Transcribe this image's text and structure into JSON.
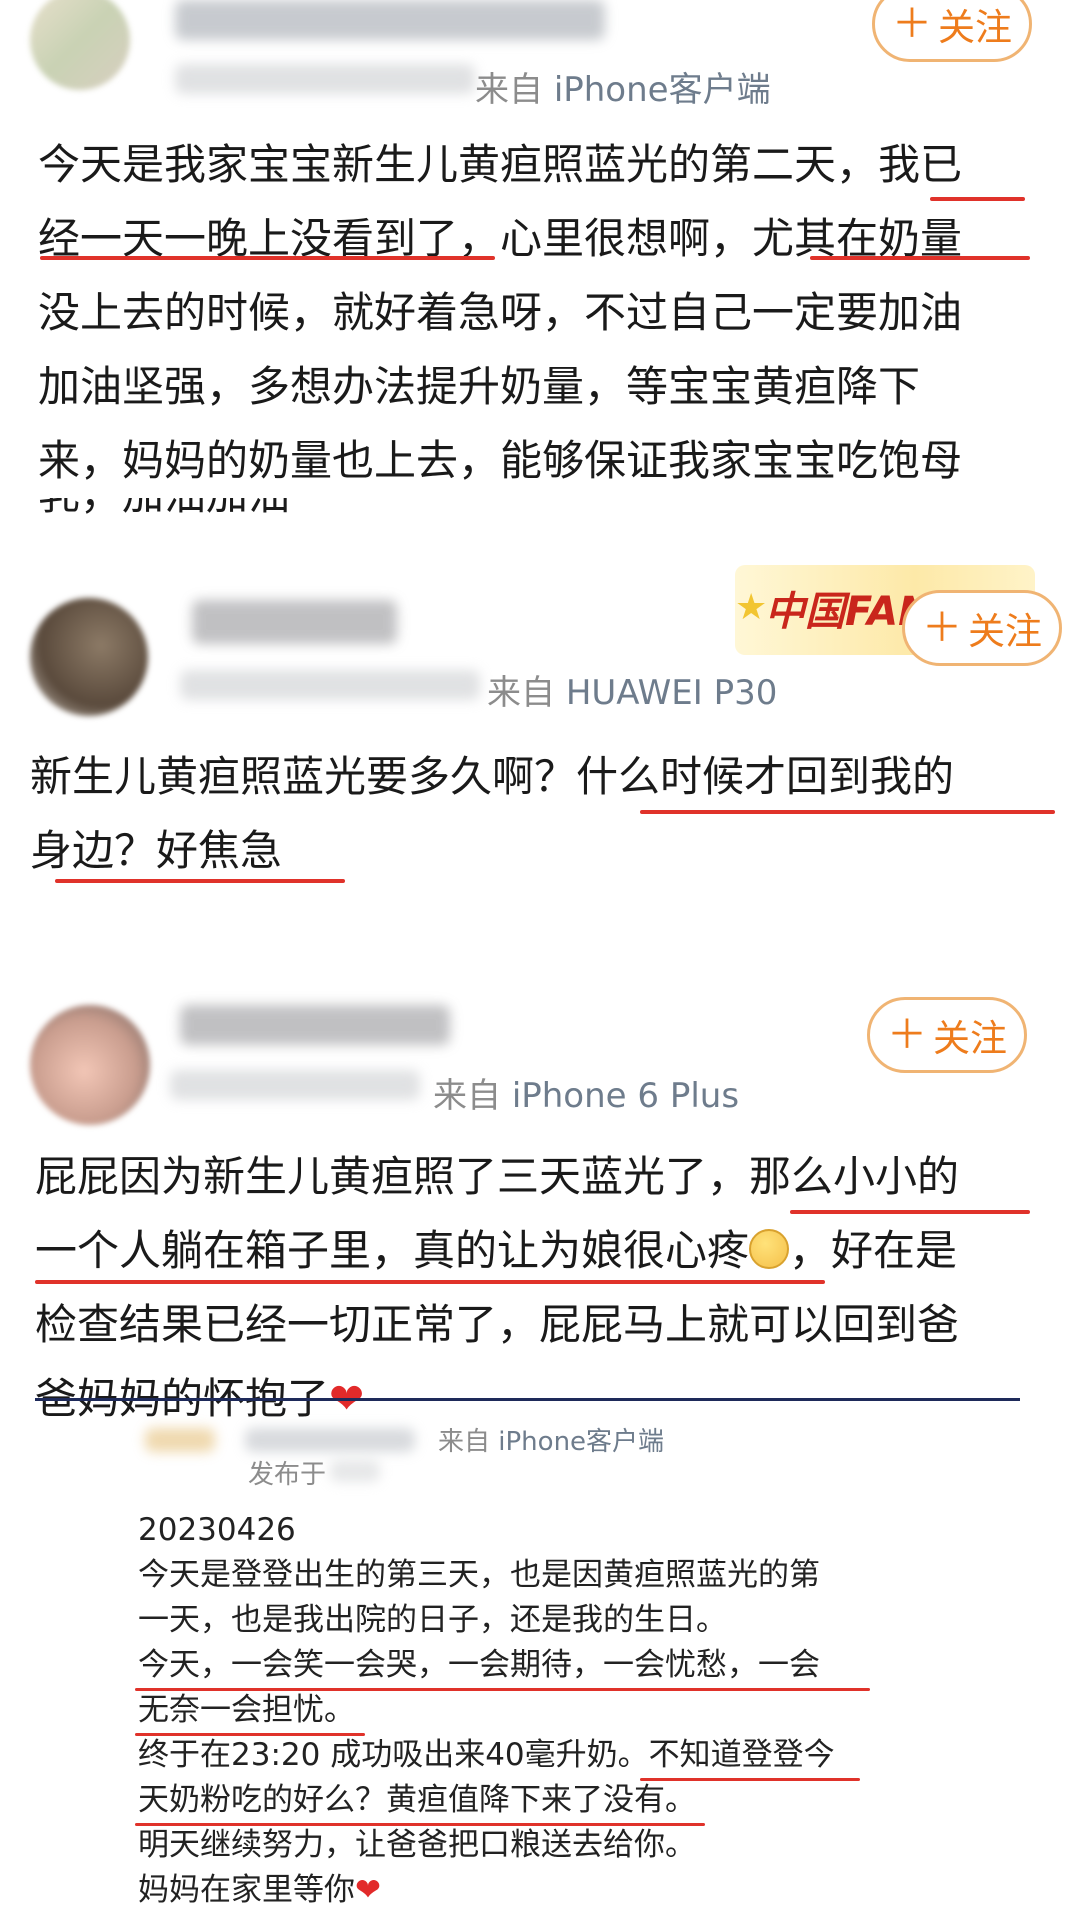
{
  "posts": [
    {
      "source_prefix": "来自",
      "device": "iPhone客户端",
      "follow_label": "关注",
      "lines": [
        "今天是我家宝宝新生儿黄疸照蓝光的第二天，我已",
        "经一天一晚上没看到了，心里很想啊，尤其在奶量",
        "没上去的时候，就好着急呀，不过自己一定要加油",
        "加油坚强，多想办法提升奶量，等宝宝黄疸降下",
        "来，妈妈的奶量也上去，能够保证我家宝宝吃饱母",
        "乳，加油加油"
      ]
    },
    {
      "source_prefix": "来自",
      "device": "HUAWEI P30",
      "follow_label": "关注",
      "badge_text": "中国FANS",
      "lines": [
        "新生儿黄疸照蓝光要多久啊？什么时候才回到我的",
        "身边？好焦急"
      ]
    },
    {
      "source_prefix": "来自",
      "device": "iPhone 6 Plus",
      "follow_label": "关注",
      "lines": [
        "屁屁因为新生儿黄疸照了三天蓝光了，那么小小的",
        "一个人躺在箱子里，真的让为娘很心疼",
        "，好在是",
        "检查结果已经一切正常了，屁屁马上就可以回到爸",
        "爸妈妈的怀抱了"
      ],
      "heart": "❤"
    },
    {
      "source_prefix": "来自",
      "device": "iPhone客户端",
      "published_prefix": "发布于",
      "lines": [
        "20230426",
        "今天是登登出生的第三天，也是因黄疸照蓝光的第",
        "一天，也是我出院的日子，还是我的生日。",
        "今天，一会笑一会哭，一会期待，一会忧愁，一会",
        "无奈一会担忧。",
        "终于在23:20 成功吸出来40毫升奶。不知道登登今",
        "天奶粉吃的好么？黄疸值降下来了没有。",
        "明天继续努力，让爸爸把口粮送去给你。",
        "妈妈在家里等你"
      ],
      "heart": "❤"
    }
  ],
  "colors": {
    "accent_orange": "#ee7c1c",
    "follow_border": "#f0b473",
    "underline_red": "#e0322a",
    "divider_navy": "#1e2a5a"
  }
}
